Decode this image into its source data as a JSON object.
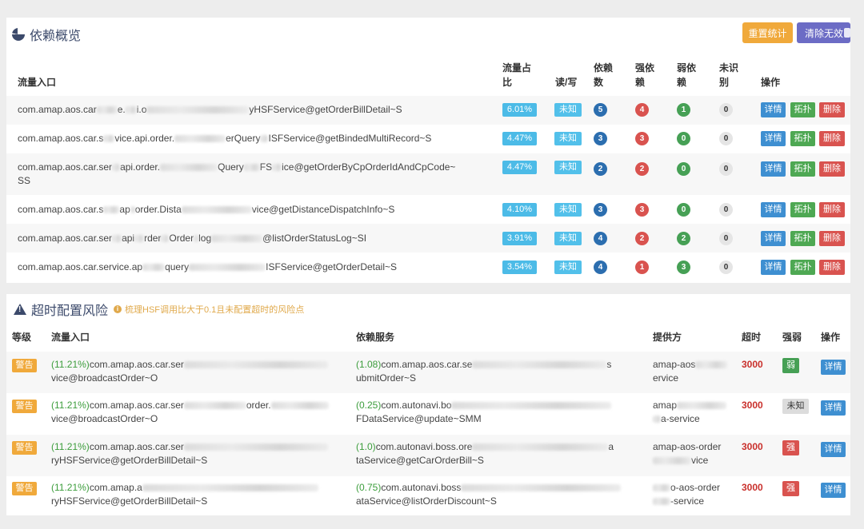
{
  "overview": {
    "title": "依赖概览",
    "reset_label": "重置统计",
    "clear_label": "清除无效",
    "headers": {
      "entry": "流量入口",
      "ratio": "流量占比",
      "rw": "读/写",
      "dep": "依赖数",
      "strong": "强依赖",
      "weak": "弱依赖",
      "unknown": "未识别",
      "ops": "操作"
    },
    "rows": [
      {
        "a": "com.amap.aos.car",
        "b": "e.",
        "c": "i.o",
        "d": "yHSFService@getOrderBillDetail~S",
        "ratio": "6.01%",
        "rw": "未知",
        "dep": "5",
        "strong": "4",
        "weak": "1",
        "unknown": "0"
      },
      {
        "a": "com.amap.aos.car.s",
        "b": "vice.",
        "c": "api.order.",
        "d": "erQuery",
        "e": "ISFService@getBindedMultiRecord~S",
        "ratio": "4.47%",
        "rw": "未知",
        "dep": "3",
        "strong": "3",
        "weak": "0",
        "unknown": "0"
      },
      {
        "a": "com.amap.aos.car.ser",
        "b": "api.order.",
        "c": "Query",
        "d": "FS",
        "e": "ice@getOrderByCpOrderIdAndCpCode~",
        "line2": "SS",
        "ratio": "4.47%",
        "rw": "未知",
        "dep": "2",
        "strong": "2",
        "weak": "0",
        "unknown": "0"
      },
      {
        "a": "com.amap.aos.car.s",
        "b": "ap",
        "c": "order.Dista",
        "d": "vice@getDistanceDispatchInfo~S",
        "ratio": "4.10%",
        "rw": "未知",
        "dep": "3",
        "strong": "3",
        "weak": "0",
        "unknown": "0"
      },
      {
        "a": "com.amap.aos.car.ser",
        "b": "api",
        "c": "rder",
        "d": "Order",
        "e": "log",
        "f": "@listOrderStatusLog~SI",
        "ratio": "3.91%",
        "rw": "未知",
        "dep": "4",
        "strong": "2",
        "weak": "2",
        "unknown": "0"
      },
      {
        "a": "com.amap.aos.car.service.ap",
        "b": "query",
        "c": "ISFService@getOrderDetail~S",
        "ratio": "3.54%",
        "rw": "未知",
        "dep": "4",
        "strong": "1",
        "weak": "3",
        "unknown": "0"
      }
    ],
    "btn_detail": "详情",
    "btn_topo": "拓扑",
    "btn_delete": "删除"
  },
  "timeout": {
    "title": "超时配置风险",
    "tip": "梳理HSF调用比大于0.1且未配置超时的风险点",
    "headers": {
      "level": "等级",
      "entry": "流量入口",
      "service": "依赖服务",
      "provider": "提供方",
      "timeout": "超时",
      "strength": "强弱",
      "ops": "操作"
    },
    "rows": [
      {
        "level": "警告",
        "e_pct": "(11.21%)",
        "e1": "com.amap.aos.car.ser",
        "e2": "vice@broadcastOrder~O",
        "s_pct": "(1.08)",
        "s1": "com.amap.aos.car.se",
        "s1b": "s",
        "s2": "ubmitOrder~S",
        "p1": "amap-aos",
        "p2": "ervice",
        "timeout": "3000",
        "strength": "弱",
        "strength_type": "weak"
      },
      {
        "level": "警告",
        "e_pct": "(11.21%)",
        "e1": "com.amap.aos.car.ser",
        "e1b": "order.",
        "e2": "vice@broadcastOrder~O",
        "s_pct": "(0.25)",
        "s1": "com.autonavi.bo",
        "s2": "FDataService@update~SMM",
        "p1": "amap",
        "p2": "a-service",
        "timeout": "3000",
        "strength": "未知",
        "strength_type": "unknown"
      },
      {
        "level": "警告",
        "e_pct": "(11.21%)",
        "e1": "com.amap.aos.car.ser",
        "e2": "ryHSFService@getOrderBillDetail~S",
        "s_pct": "(1.0)",
        "s1": "com.autonavi.boss.ore",
        "s1b": "a",
        "s2": "taService@getCarOrderBill~S",
        "p1": "amap-aos-order",
        "p2": "vice",
        "timeout": "3000",
        "strength": "强",
        "strength_type": "strong"
      },
      {
        "level": "警告",
        "e_pct": "(11.21%)",
        "e1": "com.amap.a",
        "e2": "ryHSFService@getOrderBillDetail~S",
        "s_pct": "(0.75)",
        "s1": "com.autonavi.boss",
        "s2": "ataService@listOrderDiscount~S",
        "p1": "o-aos-order",
        "p2": "-service",
        "timeout": "3000",
        "strength": "强",
        "strength_type": "strong"
      }
    ],
    "btn_detail": "详情"
  }
}
